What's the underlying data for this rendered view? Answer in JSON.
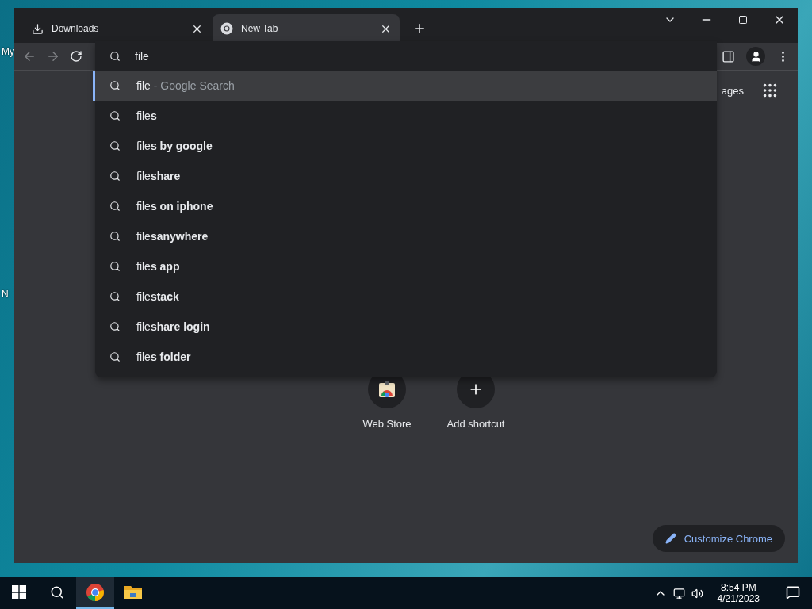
{
  "desktop_icons": [
    "My",
    "N"
  ],
  "tabs": [
    {
      "label": "Downloads",
      "kind": "download",
      "selected": false
    },
    {
      "label": "New Tab",
      "kind": "chrome",
      "selected": true
    }
  ],
  "omnibox": {
    "value": "file"
  },
  "suggestions": [
    {
      "text": "file",
      "suffix": "- Google Search",
      "selected": true
    },
    {
      "text": "file**s**",
      "selected": false
    },
    {
      "text": "file**s by google**",
      "selected": false
    },
    {
      "text": "file**share**",
      "selected": false
    },
    {
      "text": "file**s on iphone**",
      "selected": false
    },
    {
      "text": "file**sanywhere**",
      "selected": false
    },
    {
      "text": "file**s app**",
      "selected": false
    },
    {
      "text": "file**stack**",
      "selected": false
    },
    {
      "text": "file**share login**",
      "selected": false
    },
    {
      "text": "file**s folder**",
      "selected": false
    }
  ],
  "page": {
    "images_link": "ages",
    "shortcuts": [
      {
        "label": "Web Store",
        "kind": "store"
      },
      {
        "label": "Add shortcut",
        "kind": "add"
      }
    ],
    "customize": "Customize Chrome"
  },
  "taskbar": {
    "apps": [
      {
        "kind": "chrome",
        "selected": true
      },
      {
        "kind": "explorer",
        "selected": false
      }
    ],
    "time": "8:54 PM",
    "date": "4/21/2023"
  }
}
